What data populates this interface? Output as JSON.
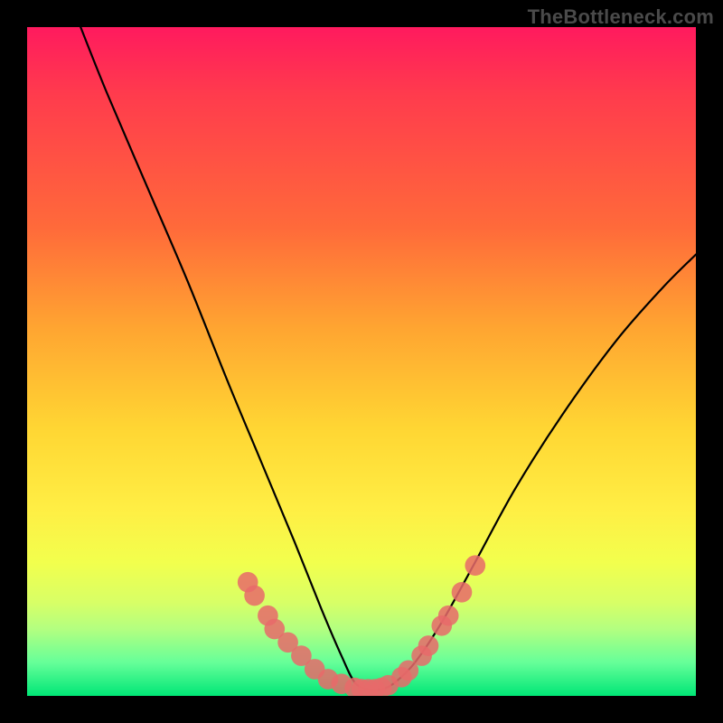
{
  "watermark": "TheBottleneck.com",
  "chart_data": {
    "type": "line",
    "title": "",
    "xlabel": "",
    "ylabel": "",
    "xlim": [
      0,
      100
    ],
    "ylim": [
      0,
      100
    ],
    "series": [
      {
        "name": "bottleneck-curve",
        "x": [
          8,
          12,
          18,
          24,
          30,
          35,
          40,
          44,
          47,
          49,
          51,
          53,
          55,
          58,
          62,
          67,
          73,
          80,
          88,
          95,
          100
        ],
        "y": [
          100,
          90,
          76,
          62,
          47,
          35,
          23,
          13,
          6,
          2,
          1,
          1,
          2,
          5,
          11,
          20,
          31,
          42,
          53,
          61,
          66
        ]
      }
    ],
    "markers": [
      {
        "x": 33,
        "y": 17,
        "r": 1.1
      },
      {
        "x": 34,
        "y": 15,
        "r": 1.1
      },
      {
        "x": 36,
        "y": 12,
        "r": 1.1
      },
      {
        "x": 37,
        "y": 10,
        "r": 1.1
      },
      {
        "x": 39,
        "y": 8,
        "r": 1.1
      },
      {
        "x": 41,
        "y": 6,
        "r": 1.1
      },
      {
        "x": 43,
        "y": 4,
        "r": 1.1
      },
      {
        "x": 45,
        "y": 2.5,
        "r": 1.1
      },
      {
        "x": 47,
        "y": 1.8,
        "r": 1.1
      },
      {
        "x": 49,
        "y": 1.2,
        "r": 1.1
      },
      {
        "x": 50,
        "y": 1.0,
        "r": 1.1
      },
      {
        "x": 51,
        "y": 1.0,
        "r": 1.1
      },
      {
        "x": 52,
        "y": 1.0,
        "r": 1.1
      },
      {
        "x": 53,
        "y": 1.2,
        "r": 1.1
      },
      {
        "x": 54,
        "y": 1.6,
        "r": 1.1
      },
      {
        "x": 56,
        "y": 2.8,
        "r": 1.1
      },
      {
        "x": 57,
        "y": 3.8,
        "r": 1.1
      },
      {
        "x": 59,
        "y": 6.0,
        "r": 1.1
      },
      {
        "x": 60,
        "y": 7.5,
        "r": 1.1
      },
      {
        "x": 62,
        "y": 10.5,
        "r": 1.1
      },
      {
        "x": 63,
        "y": 12.0,
        "r": 1.1
      },
      {
        "x": 65,
        "y": 15.5,
        "r": 1.1
      },
      {
        "x": 67,
        "y": 19.5,
        "r": 1.1
      }
    ],
    "marker_color": "#e86a6a",
    "curve_color": "#000000"
  }
}
